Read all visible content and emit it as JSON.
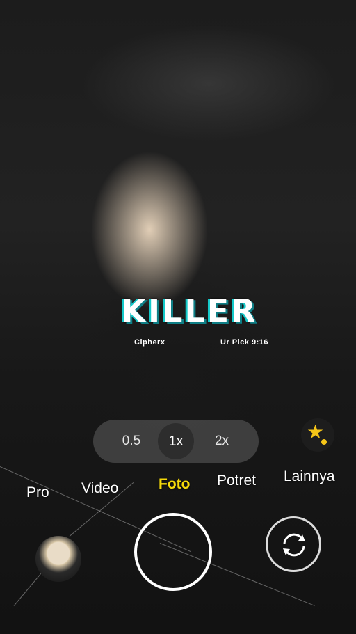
{
  "viewfinder": {
    "subject": "camera preview"
  },
  "sticker": {
    "title": "KILLER",
    "subtitle_left": "Cipherx",
    "subtitle_right": "Ur Pick 9:16"
  },
  "zoom": {
    "options": [
      "0.5",
      "1x",
      "2x"
    ],
    "selected": "1x"
  },
  "ai_button": {
    "icon": "star-icon"
  },
  "modes": {
    "items": [
      "Pro",
      "Video",
      "Foto",
      "Potret",
      "Lainnya"
    ],
    "active": "Foto",
    "active_color": "#f5d90a"
  },
  "controls": {
    "gallery_icon": "gallery-thumbnail",
    "shutter_icon": "shutter-button",
    "switch_icon": "switch-camera-icon"
  },
  "colors": {
    "accent": "#f5c518",
    "sticker_cyan": "#14c9c9"
  }
}
